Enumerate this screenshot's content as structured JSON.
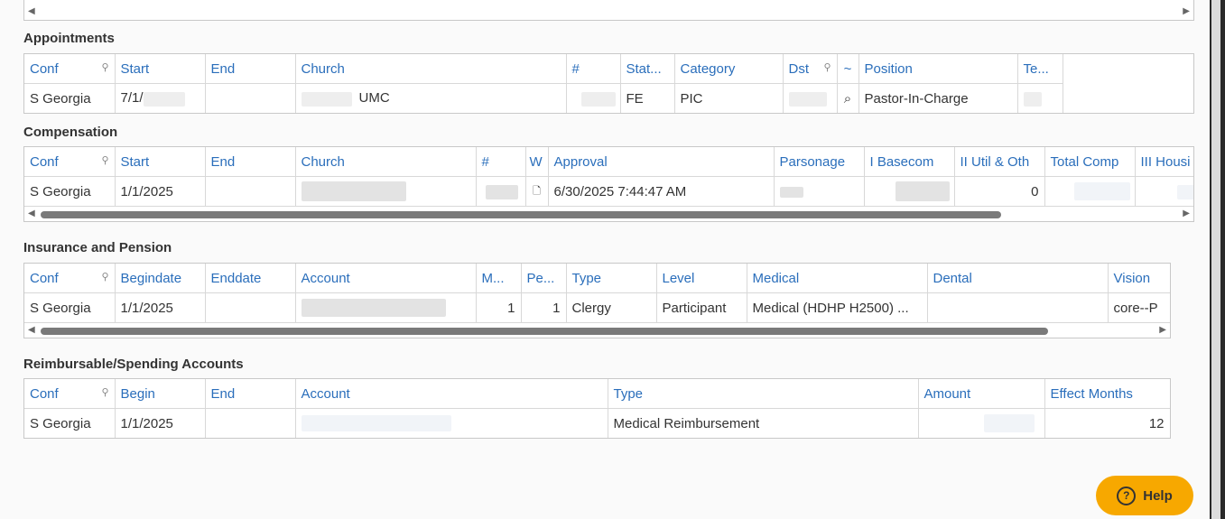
{
  "appointments": {
    "title": "Appointments",
    "headers": [
      "Conf",
      "Start",
      "End",
      "Church",
      "#",
      "Stat...",
      "Category",
      "Dst",
      "~",
      "Position",
      "Te..."
    ],
    "row": {
      "conf": "S Georgia",
      "start": "7/1/",
      "end": "",
      "church": "UMC",
      "num": "",
      "status": "FE",
      "category": "PIC",
      "dst": "",
      "position": "Pastor-In-Charge",
      "te": ""
    }
  },
  "compensation": {
    "title": "Compensation",
    "headers": [
      "Conf",
      "Start",
      "End",
      "Church",
      "#",
      "W",
      "Approval",
      "Parsonage",
      "I Basecom",
      "II Util & Oth",
      "Total Comp",
      "III Housi"
    ],
    "row": {
      "conf": "S Georgia",
      "start": "1/1/2025",
      "end": "",
      "church": "",
      "num": "",
      "approval": "6/30/2025 7:44:47 AM",
      "util": "0"
    }
  },
  "insurance": {
    "title": "Insurance and Pension",
    "headers": [
      "Conf",
      "Begindate",
      "Enddate",
      "Account",
      "M...",
      "Pe...",
      "Type",
      "Level",
      "Medical",
      "Dental",
      "Vision"
    ],
    "row": {
      "conf": "S Georgia",
      "begindate": "1/1/2025",
      "enddate": "",
      "account": "",
      "m": "1",
      "pe": "1",
      "type": "Clergy",
      "level": "Participant",
      "medical": "Medical (HDHP H2500) ...",
      "dental": "",
      "vision": "core--P"
    }
  },
  "reimbursable": {
    "title": "Reimbursable/Spending Accounts",
    "headers": [
      "Conf",
      "Begin",
      "End",
      "Account",
      "Type",
      "Amount",
      "Effect Months"
    ],
    "row": {
      "conf": "S Georgia",
      "begin": "1/1/2025",
      "end": "",
      "account": "",
      "type": "Medical Reimbursement",
      "amount": "",
      "effect_months": "12"
    }
  },
  "help": {
    "label": "Help"
  },
  "icons": {
    "pin": "pin-icon",
    "search": "magnifier-icon",
    "document": "document-icon",
    "help": "question-circle-icon"
  },
  "colors": {
    "header_text": "#2a6ebb",
    "help_button": "#f7a800"
  }
}
